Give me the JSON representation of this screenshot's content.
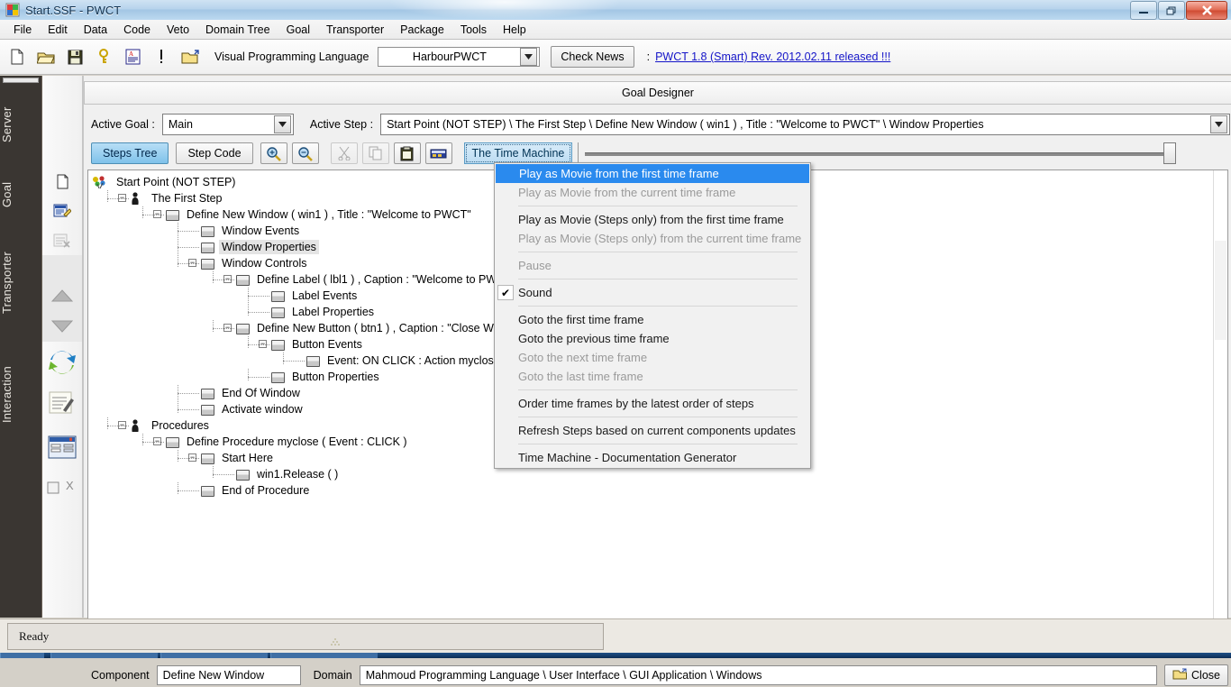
{
  "window": {
    "title": "Start.SSF  - PWCT",
    "minimize_label": "–",
    "maximize_label": "❐",
    "close_label": "✕"
  },
  "menubar": {
    "items": [
      {
        "label": "File"
      },
      {
        "label": "Edit"
      },
      {
        "label": "Data"
      },
      {
        "label": "Code"
      },
      {
        "label": "Veto"
      },
      {
        "label": "Domain Tree"
      },
      {
        "label": "Goal"
      },
      {
        "label": "Transporter"
      },
      {
        "label": "Package"
      },
      {
        "label": "Tools"
      },
      {
        "label": "Help"
      }
    ]
  },
  "toolbar": {
    "icons": [
      {
        "name": "new-file-icon"
      },
      {
        "name": "open-folder-icon"
      },
      {
        "name": "save-icon"
      },
      {
        "name": "key-icon"
      },
      {
        "name": "document-properties-icon"
      },
      {
        "name": "exclamation-icon"
      },
      {
        "name": "open-folder-up-icon"
      }
    ],
    "language_label": "Visual Programming Language",
    "language_value": "HarbourPWCT",
    "check_news_label": "Check News",
    "news_colon": ":",
    "news_link": "PWCT 1.8 (Smart) Rev. 2012.02.11 released !!!",
    "link_color": "#1414c8"
  },
  "sidebar": {
    "tabs": [
      {
        "label": "Server"
      },
      {
        "label": "Goal"
      },
      {
        "label": "Transporter"
      },
      {
        "label": "Interaction"
      }
    ],
    "icons": [
      {
        "name": "new-page-icon"
      },
      {
        "name": "edit-form-icon"
      },
      {
        "name": "delete-form-icon"
      },
      {
        "name": "move-up-icon"
      },
      {
        "name": "move-down-icon"
      },
      {
        "name": "refresh-icon"
      },
      {
        "name": "notes-icon"
      },
      {
        "name": "window-form-icon"
      },
      {
        "name": "close-x-icon"
      },
      {
        "name": "close-x-label"
      }
    ],
    "close_x_label": "X"
  },
  "designer": {
    "title": "Goal Designer",
    "active_goal_label": "Active Goal :",
    "active_goal_value": "Main",
    "active_step_label": "Active Step :",
    "active_step_value": "Start Point (NOT STEP) \\ The First Step \\ Define New Window  ( win1 ) , Title : \"Welcome to PWCT\" \\ Window Properties",
    "tabs": [
      {
        "label": "Steps Tree",
        "active": true
      },
      {
        "label": "Step Code",
        "active": false
      }
    ],
    "tools": [
      {
        "name": "zoom-in-icon",
        "disabled": false
      },
      {
        "name": "zoom-out-icon",
        "disabled": false
      },
      {
        "name": "cut-icon",
        "disabled": true
      },
      {
        "name": "copy-icon",
        "disabled": true
      },
      {
        "name": "paste-icon",
        "disabled": false
      },
      {
        "name": "find-icon",
        "disabled": false
      }
    ],
    "time_machine_label": "The Time Machine"
  },
  "tree": {
    "nodes": [
      {
        "indent": 0,
        "label": "Start Point (NOT STEP)",
        "icon": "start-point-icon",
        "toggle": "none",
        "selected": false
      },
      {
        "indent": 1,
        "label": "The First Step",
        "icon": "person-icon",
        "toggle": "minus",
        "selected": false
      },
      {
        "indent": 2,
        "label": "Define New Window  ( win1 ) , Title : \"Welcome to PWCT\"",
        "icon": "box-icon",
        "toggle": "minus",
        "selected": false
      },
      {
        "indent": 3,
        "label": "Window Events",
        "icon": "box-icon",
        "toggle": "none",
        "selected": false
      },
      {
        "indent": 3,
        "label": "Window Properties",
        "icon": "box-icon",
        "toggle": "none",
        "selected": true
      },
      {
        "indent": 3,
        "label": "Window Controls",
        "icon": "box-icon",
        "toggle": "minus",
        "selected": false
      },
      {
        "indent": 4,
        "label": "Define Label ( lbl1 ) , Caption : \"Welcome to PWCT\"",
        "icon": "box-icon",
        "toggle": "minus",
        "selected": false
      },
      {
        "indent": 5,
        "label": "Label Events",
        "icon": "box-icon",
        "toggle": "none",
        "selected": false
      },
      {
        "indent": 5,
        "label": "Label Properties",
        "icon": "box-icon",
        "toggle": "none",
        "selected": false
      },
      {
        "indent": 4,
        "label": "Define New Button ( btn1 ) , Caption : \"Close Window\"",
        "icon": "box-icon",
        "toggle": "minus",
        "selected": false
      },
      {
        "indent": 5,
        "label": "Button Events",
        "icon": "box-icon",
        "toggle": "minus",
        "selected": false
      },
      {
        "indent": 6,
        "label": "Event: ON CLICK : Action myclose",
        "icon": "box-icon",
        "toggle": "none",
        "selected": false
      },
      {
        "indent": 5,
        "label": "Button Properties",
        "icon": "box-icon",
        "toggle": "none",
        "selected": false
      },
      {
        "indent": 3,
        "label": "End Of Window",
        "icon": "box-icon",
        "toggle": "none",
        "selected": false
      },
      {
        "indent": 3,
        "label": "Activate window",
        "icon": "box-icon",
        "toggle": "none",
        "selected": false
      },
      {
        "indent": 1,
        "label": "Procedures",
        "icon": "person-icon",
        "toggle": "minus",
        "selected": false
      },
      {
        "indent": 2,
        "label": "Define Procedure myclose ( Event : CLICK )",
        "icon": "box-icon",
        "toggle": "minus",
        "selected": false
      },
      {
        "indent": 3,
        "label": "Start Here",
        "icon": "box-icon",
        "toggle": "minus",
        "selected": false
      },
      {
        "indent": 4,
        "label": "win1.Release ( )",
        "icon": "box-icon",
        "toggle": "none",
        "selected": false
      },
      {
        "indent": 3,
        "label": "End of Procedure",
        "icon": "box-icon",
        "toggle": "none",
        "selected": false
      }
    ]
  },
  "context_menu": {
    "items": [
      {
        "label": "Play as Movie from the first time frame",
        "state": "highlighted"
      },
      {
        "label": "Play as Movie from the current time frame",
        "state": "disabled"
      },
      {
        "separator": true
      },
      {
        "label": "Play as Movie (Steps only) from the first time frame",
        "state": "normal"
      },
      {
        "label": "Play as Movie (Steps only) from the current time frame",
        "state": "disabled"
      },
      {
        "separator": true
      },
      {
        "label": "Pause",
        "state": "disabled"
      },
      {
        "separator": true
      },
      {
        "label": "Sound",
        "state": "checked"
      },
      {
        "separator": true
      },
      {
        "label": "Goto the first time frame",
        "state": "normal"
      },
      {
        "label": "Goto the previous time frame",
        "state": "normal"
      },
      {
        "label": "Goto the next time frame",
        "state": "disabled"
      },
      {
        "label": "Goto the last time frame",
        "state": "disabled"
      },
      {
        "separator": true
      },
      {
        "label": "Order time frames by the latest order of steps",
        "state": "normal"
      },
      {
        "separator": true
      },
      {
        "label": "Refresh Steps based on current components updates",
        "state": "normal"
      },
      {
        "separator": true
      },
      {
        "label": "Time Machine - Documentation Generator",
        "state": "normal"
      }
    ],
    "check_glyph": "✔",
    "highlight_color": "#2a8aee"
  },
  "component_bar": {
    "component_label": "Component",
    "component_value": "Define New Window",
    "domain_label": "Domain",
    "domain_value": "Mahmoud Programming Language \\ User Interface \\ GUI Application \\ Windows",
    "close_label": "Close"
  },
  "status": {
    "text": "Ready"
  }
}
